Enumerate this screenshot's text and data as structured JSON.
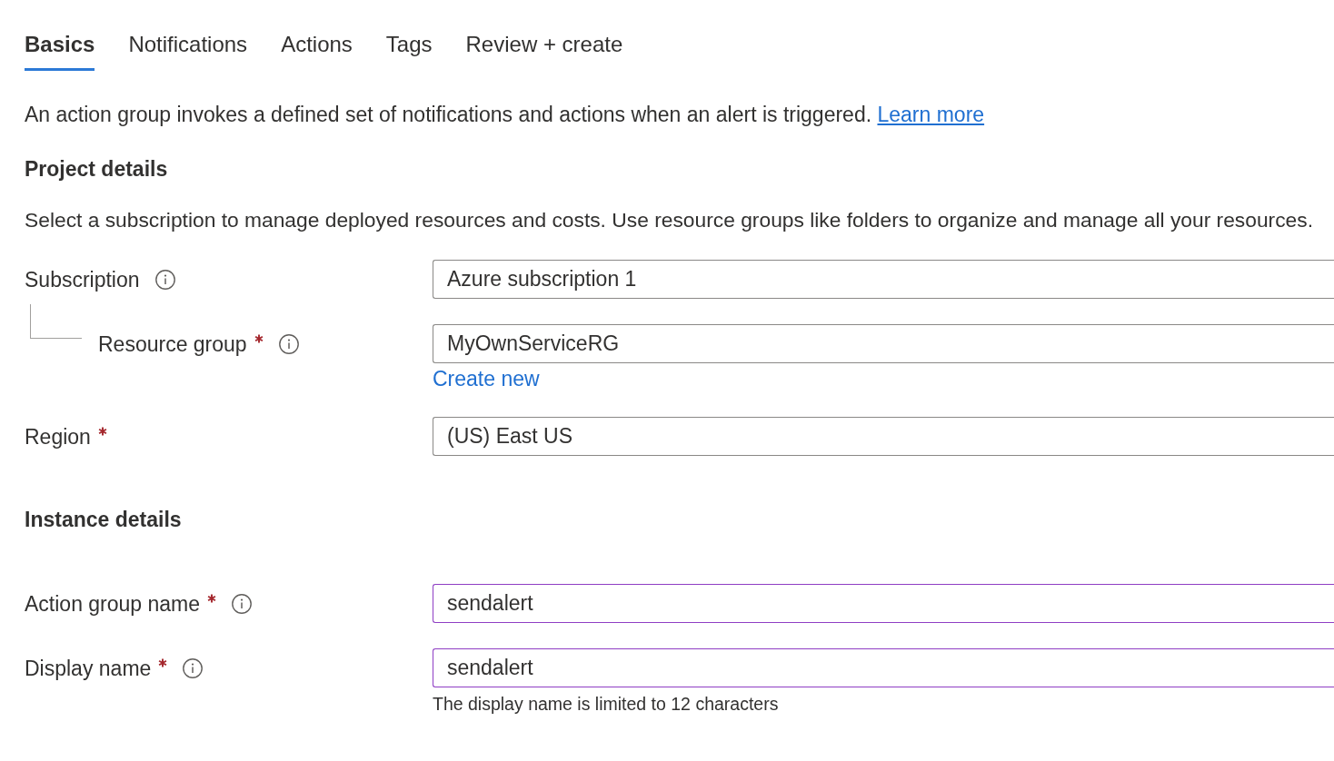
{
  "tabs": [
    {
      "label": "Basics",
      "selected": true
    },
    {
      "label": "Notifications",
      "selected": false
    },
    {
      "label": "Actions",
      "selected": false
    },
    {
      "label": "Tags",
      "selected": false
    },
    {
      "label": "Review + create",
      "selected": false
    }
  ],
  "intro": {
    "text": "An action group invokes a defined set of notifications and actions when an alert is triggered.",
    "link": "Learn more"
  },
  "sections": [
    {
      "heading": "Project details",
      "description": "Select a subscription to manage deployed resources and costs. Use resource groups like folders to organize and manage all your resources.",
      "fields": [
        {
          "label": "Subscription",
          "required": false,
          "info": true,
          "kind": "dropdown",
          "value": "Azure subscription 1",
          "children": [
            {
              "label": "Resource group",
              "required": true,
              "info": true,
              "kind": "dropdown",
              "value": "MyOwnServiceRG",
              "link": "Create new"
            }
          ]
        },
        {
          "label": "Region",
          "required": true,
          "info": false,
          "kind": "dropdown",
          "value": "(US) East US"
        }
      ]
    },
    {
      "heading": "Instance details",
      "fields": [
        {
          "label": "Action group name",
          "required": true,
          "info": true,
          "kind": "text",
          "value": "sendalert"
        },
        {
          "label": "Display name",
          "required": true,
          "info": true,
          "kind": "text",
          "value": "sendalert",
          "hint": "The display name is limited to 12 characters"
        }
      ]
    }
  ]
}
